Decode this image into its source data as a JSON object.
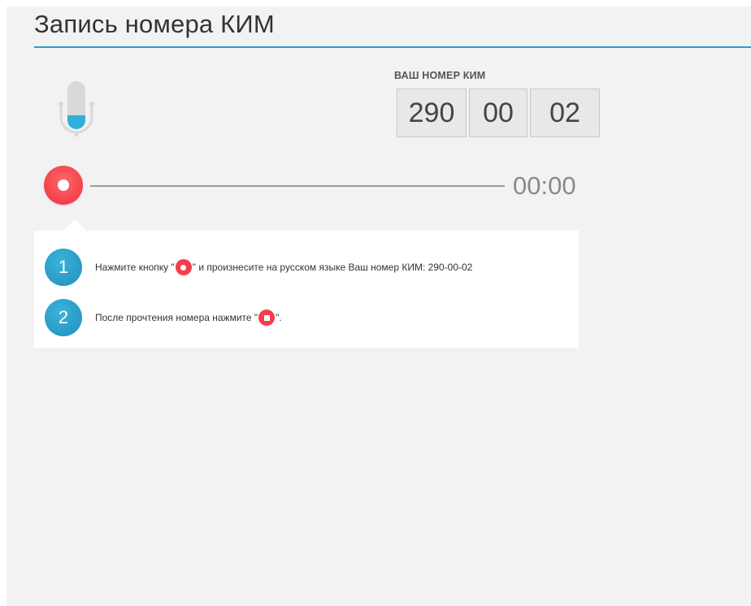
{
  "page": {
    "title": "Запись номера КИМ"
  },
  "kim": {
    "label": "ВАШ НОМЕР КИМ",
    "parts": [
      "290",
      "00",
      "02"
    ]
  },
  "recorder": {
    "timer": "00:00",
    "progress": 0,
    "record_icon": "record-icon",
    "mic_icon": "microphone-icon"
  },
  "instructions": {
    "step1": {
      "number": "1",
      "text_before": "Нажмите кнопку \"",
      "text_after": "\" и произнесите на русском языке Ваш номер КИМ: 290-00-02"
    },
    "step2": {
      "number": "2",
      "text_before": "После прочтения номера нажмите \"",
      "text_after": "\"."
    }
  },
  "colors": {
    "accent": "#2aa0c8",
    "record": "#f43f4a",
    "background": "#f2f2f2"
  }
}
